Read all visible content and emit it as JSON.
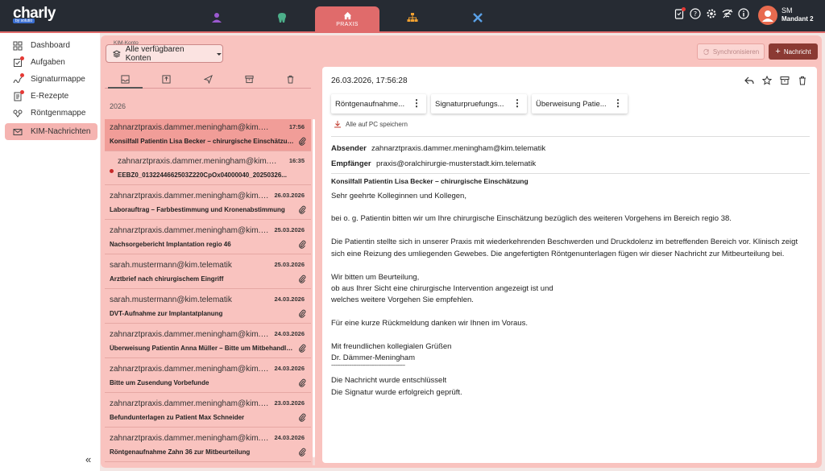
{
  "app": {
    "logo": "charly",
    "logo_sub": "by solutio",
    "active_module": "PRAXIS",
    "user_initials": "SM",
    "user_name": "Mandant 2"
  },
  "sidebar": {
    "items": [
      {
        "label": "Dashboard",
        "icon": "dashboard-icon"
      },
      {
        "label": "Aufgaben",
        "icon": "tasks-icon",
        "badge": true
      },
      {
        "label": "Signaturmappe",
        "icon": "signature-icon",
        "badge": true
      },
      {
        "label": "E-Rezepte",
        "icon": "prescription-icon",
        "badge": true
      },
      {
        "label": "Röntgenmappe",
        "icon": "xray-icon"
      },
      {
        "label": "KIM-Nachrichten",
        "icon": "mail-icon",
        "active": true
      }
    ]
  },
  "toolbar": {
    "konto_label": "KIM-Konto",
    "konto_value": "Alle verfügbaren Konten",
    "sync_label": "Synchronisieren",
    "new_label": "Nachricht"
  },
  "list": {
    "year": "2026",
    "messages": [
      {
        "sender": "zahnarztpraxis.dammer.meningham@kim.telematik",
        "date": "17:56",
        "subject": "Konsilfall Patientin Lisa Becker – chirurgische Einschätzung",
        "attachment": true,
        "selected": true
      },
      {
        "sender": "zahnarztpraxis.dammer.meningham@kim.telematik",
        "date": "16:35",
        "subject": "EEBZ0_0132244662503Z220CpOx04000040_20250326...",
        "attachment": false,
        "unread": true
      },
      {
        "sender": "zahnarztpraxis.dammer.meningham@kim.telematik",
        "date": "26.03.2026",
        "subject": "Laborauftrag – Farbbestimmung und Kronenabstimmung",
        "attachment": true
      },
      {
        "sender": "zahnarztpraxis.dammer.meningham@kim.telematik",
        "date": "25.03.2026",
        "subject": "Nachsorgebericht Implantation regio 46",
        "attachment": true
      },
      {
        "sender": "sarah.mustermann@kim.telematik",
        "date": "25.03.2026",
        "subject": "Arztbrief nach chirurgischem Eingriff",
        "attachment": true
      },
      {
        "sender": "sarah.mustermann@kim.telematik",
        "date": "24.03.2026",
        "subject": "DVT-Aufnahme zur Implantatplanung",
        "attachment": true
      },
      {
        "sender": "zahnarztpraxis.dammer.meningham@kim.telematik",
        "date": "24.03.2026",
        "subject": "Überweisung Patientin Anna Müller – Bitte um Mitbehandlung",
        "attachment": true
      },
      {
        "sender": "zahnarztpraxis.dammer.meningham@kim.telematik",
        "date": "24.03.2026",
        "subject": "Bitte um Zusendung Vorbefunde",
        "attachment": true
      },
      {
        "sender": "zahnarztpraxis.dammer.meningham@kim.telematik",
        "date": "23.03.2026",
        "subject": "Befundunterlagen zu Patient Max Schneider",
        "attachment": true
      },
      {
        "sender": "zahnarztpraxis.dammer.meningham@kim.telematik",
        "date": "24.03.2026",
        "subject": "Röntgenaufnahme Zahn 36 zur Mitbeurteilung",
        "attachment": true
      }
    ]
  },
  "detail": {
    "datetime": "26.03.2026, 17:56:28",
    "attachments": [
      "Röntgenaufnahme...",
      "Signaturpruefungs...",
      "Überweisung Patie..."
    ],
    "save_all": "Alle auf PC speichern",
    "sender_label": "Absender",
    "sender": "zahnarztpraxis.dammer.meningham@kim.telematik",
    "recipient_label": "Empfänger",
    "recipient": "praxis@oralchirurgie-musterstadt.kim.telematik",
    "subject": "Konsilfall Patientin Lisa Becker – chirurgische Einschätzung",
    "body": [
      "Sehr geehrte Kolleginnen und Kollegen,",
      "",
      "bei o. g. Patientin bitten wir um Ihre chirurgische Einschätzung bezüglich des weiteren Vorgehens im Bereich regio 38.",
      "",
      "Die Patientin stellte sich in unserer Praxis mit wiederkehrenden Beschwerden und Druckdolenz im betreffenden Bereich vor. Klinisch zeigt",
      "sich eine Reizung des umliegenden Gewebes. Die angefertigten Röntgenunterlagen fügen wir dieser Nachricht zur Mitbeurteilung bei.",
      "",
      "Wir bitten um Beurteilung,",
      "ob aus Ihrer Sicht eine chirurgische Intervention angezeigt ist und",
      "welches weitere Vorgehen Sie empfehlen.",
      "",
      "Für eine kurze Rückmeldung danken wir Ihnen im Voraus.",
      "",
      "Mit freundlichen kollegialen Grüßen",
      "Dr. Dämmer-Meningham",
      "--------------------------------------------------",
      "Die Nachricht wurde entschlüsselt",
      "Die Signatur wurde erfolgreich geprüft."
    ]
  },
  "colors": {
    "accent": "#e06b6b",
    "topbar": "#262b33",
    "panel": "#f9c3bf",
    "primary_button": "#8b3a33"
  }
}
